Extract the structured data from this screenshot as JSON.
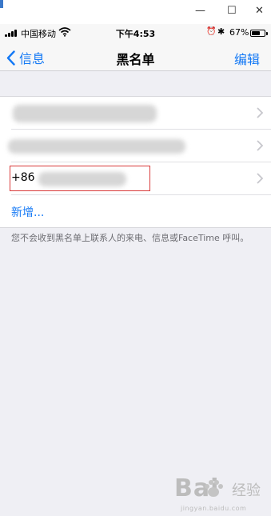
{
  "window_controls": {
    "minimize": "—",
    "maximize": "☐",
    "close": "✕"
  },
  "status": {
    "carrier": "中国移动",
    "time": "下午4:53",
    "battery_pct": "67%",
    "battery_level": 0.67
  },
  "nav": {
    "back_label": "信息",
    "title": "黑名单",
    "edit_label": "编辑"
  },
  "list": {
    "entry3_prefix": "+86",
    "add_label": "新增..."
  },
  "footer_note": "您不会收到黑名单上联系人的来电、信息或FaceTime 呼叫。",
  "watermark": {
    "brand": "Bai",
    "brand2": "经验",
    "sub": "jingyan.baidu.com"
  },
  "icons": [
    "signal-icon",
    "wifi-icon",
    "alarm-icon",
    "bluetooth-icon",
    "battery-icon",
    "back-chevron-icon",
    "chevron-right-icon"
  ]
}
